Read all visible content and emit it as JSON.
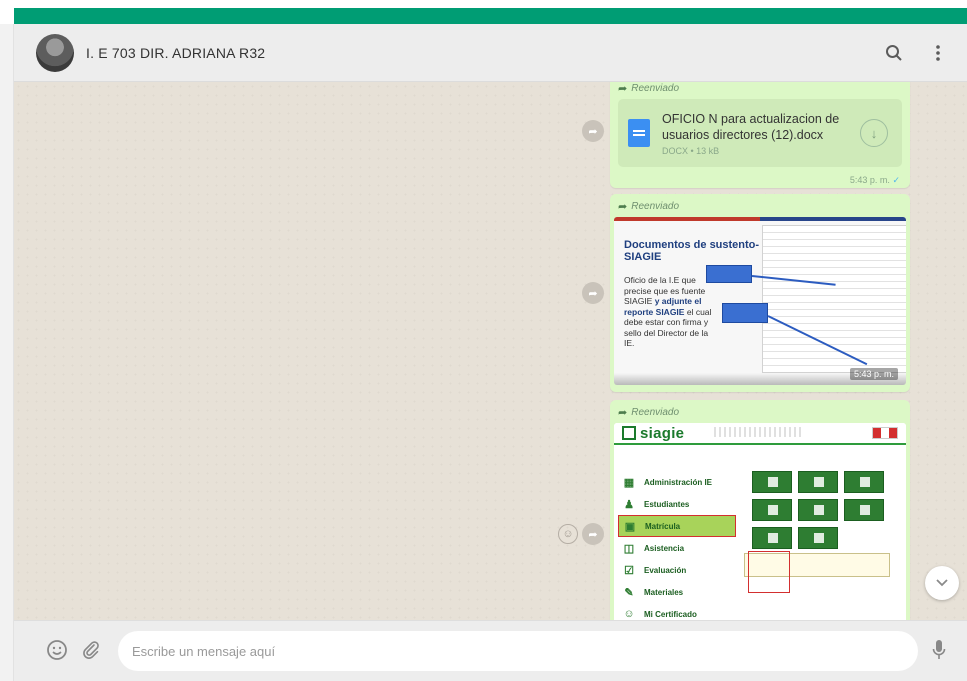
{
  "header": {
    "chat_title": "I. E 703 DIR. ADRIANA R32",
    "search_icon": "search-icon",
    "menu_icon": "more-vertical-icon"
  },
  "messages": [
    {
      "type": "document",
      "forwarded_label": "Reenviado",
      "file_name": "OFICIO N para actualizacion de usuarios directores (12).docx",
      "file_meta": "DOCX • 13 kB",
      "time": "5:43 p. m."
    },
    {
      "type": "image",
      "forwarded_label": "Reenviado",
      "image_title": "Documentos de sustento-SIAGIE",
      "image_body": "Oficio de la I.E que precise que es fuente SIAGIE",
      "image_body_bold": "y adjunte el reporte SIAGIE",
      "image_body_end": "el cual debe estar con firma y sello del Director de la IE.",
      "time": "5:43 p. m."
    },
    {
      "type": "image",
      "forwarded_label": "Reenviado",
      "app_name": "siagie",
      "menu": [
        "Administración IE",
        "Estudiantes",
        "Matrícula",
        "Asistencia",
        "Evaluación",
        "Materiales",
        "Mi Certificado"
      ]
    }
  ],
  "composer": {
    "placeholder": "Escribe un mensaje aquí",
    "emoji_icon": "emoji-icon",
    "attach_icon": "paperclip-icon",
    "mic_icon": "microphone-icon"
  },
  "colors": {
    "brand_green": "#009d74",
    "bubble_green": "#dcf8c6",
    "chat_bg": "#e7e1d7"
  }
}
